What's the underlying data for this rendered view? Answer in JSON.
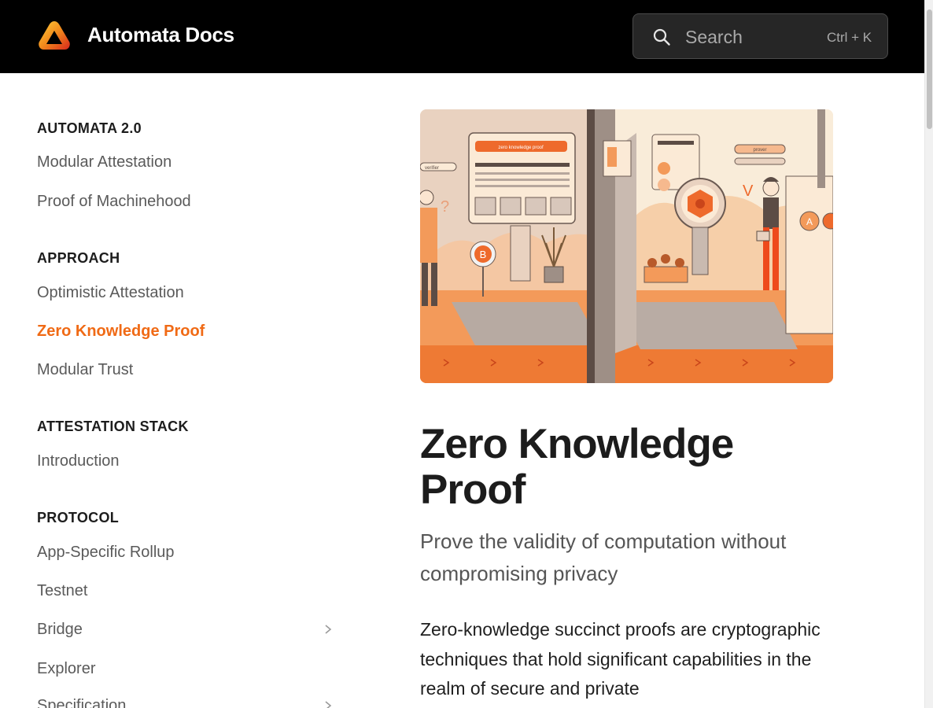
{
  "header": {
    "brand": "Automata Docs",
    "search": {
      "placeholder": "Search",
      "shortcut": "Ctrl + K"
    }
  },
  "sidebar": {
    "sections": [
      {
        "title": "AUTOMATA 2.0",
        "items": [
          "Modular Attestation",
          "Proof of Machinehood"
        ]
      },
      {
        "title": "APPROACH",
        "items": [
          "Optimistic Attestation",
          "Zero Knowledge Proof",
          "Modular Trust"
        ]
      },
      {
        "title": "ATTESTATION STACK",
        "items": [
          "Introduction"
        ]
      },
      {
        "title": "PROTOCOL",
        "items": [
          "App-Specific Rollup",
          "Testnet",
          "Bridge",
          "Explorer",
          "Specification"
        ]
      }
    ],
    "active_item": "Zero Knowledge Proof"
  },
  "hero": {
    "banner_text": "zero knowledge proof",
    "verifier_label": "verifier",
    "prover_label": "prover",
    "badge_b": "B",
    "badge_a": "A",
    "icon": "illustration"
  },
  "main": {
    "title": "Zero Knowledge Proof",
    "subtitle": "Prove the validity of computation without compromising privacy",
    "body": "Zero-knowledge succinct proofs are cryptographic techniques that hold significant capabilities in the realm of secure and private"
  },
  "colors": {
    "accent": "#f06a15",
    "header_bg": "#000000"
  }
}
